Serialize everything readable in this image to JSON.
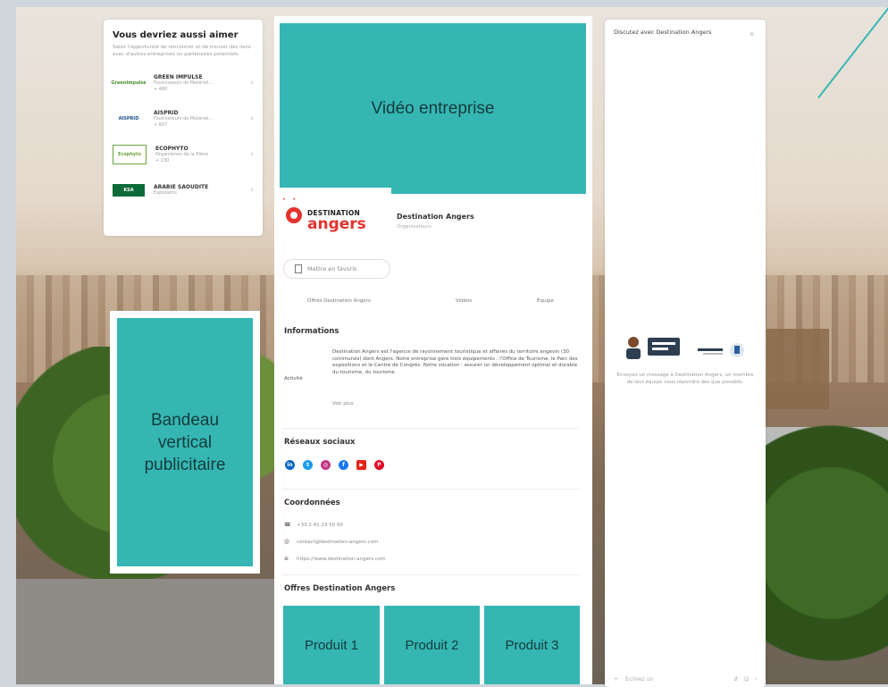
{
  "colors": {
    "accent_teal": "#35b6b3",
    "brand_red": "#e4332f"
  },
  "suggestions": {
    "title": "Vous devriez aussi aimer",
    "subtitle": "Saisir l'opportunité de rencontrer et de trouver des liens avec d'autres entreprises ou partenaires potentiels",
    "items": [
      {
        "name": "GREEN IMPULSE",
        "sub": "Fournisseurs de Matériel...",
        "sub2": "+ 480",
        "logo_text": "GreenImpulse"
      },
      {
        "name": "AISPRID",
        "sub": "Fournisseurs de Matériel...",
        "sub2": "+ 807",
        "logo_text": "AISPRID"
      },
      {
        "name": "ECOPHYTO",
        "sub": "Organismes de la filière",
        "sub2": "+ 130",
        "logo_text": "Ecophyto"
      },
      {
        "name": "ARABIE SAOUDITE",
        "sub": "Exposants",
        "sub2": "",
        "logo_text": "KSA"
      }
    ]
  },
  "placeholders": {
    "video": "Vidéo entreprise",
    "banner_line1": "Bandeau",
    "banner_line2": "vertical",
    "banner_line3": "publicitaire",
    "product1": "Produit 1",
    "product2": "Produit 2",
    "product3": "Produit 3"
  },
  "profile": {
    "logo_word1": "DESTINATION",
    "logo_word2": "angers",
    "name": "Destination Angers",
    "type": "Organisateurs",
    "favorite_label": "Mettre en favoris",
    "tabs": [
      "Offres Destination Angers",
      "Vidéos",
      "Équipe"
    ]
  },
  "informations": {
    "title": "Informations",
    "label": "Activité",
    "text": "Destination Angers est l'agence de rayonnement touristique et affaires du territoire angevin (30 communes) dont Angers. Notre entreprise gère trois équipements : l'Office de Tourisme, le Parc des expositions et le Centre de Congrès. Notre vocation : assurer un développement optimal et durable du tourisme, du tourisme",
    "see_more": "Voir plus"
  },
  "social": {
    "title": "Réseaux sociaux",
    "networks": [
      {
        "name": "linkedin-icon",
        "glyph": "in",
        "color": "#0a66c2"
      },
      {
        "name": "twitter-icon",
        "glyph": "t",
        "color": "#1d9bf0"
      },
      {
        "name": "instagram-icon",
        "glyph": "◎",
        "color": "#c13584"
      },
      {
        "name": "facebook-icon",
        "glyph": "f",
        "color": "#1877f2"
      },
      {
        "name": "youtube-icon",
        "glyph": "▶",
        "color": "#e62117"
      },
      {
        "name": "pinterest-icon",
        "glyph": "P",
        "color": "#e60023"
      }
    ]
  },
  "coordinates": {
    "title": "Coordonnées",
    "phone": "+33 2 41 23 50 00",
    "email": "contact@destination-angers.com",
    "website": "https://www.destination-angers.com"
  },
  "offers": {
    "title": "Offres Destination Angers"
  },
  "chat": {
    "title": "Discutez avec Destination Angers",
    "message": "Envoyez un message à Destination Angers, un membre de leur équipe vous répondra dès que possible.",
    "input_placeholder": "Écrivez un"
  }
}
